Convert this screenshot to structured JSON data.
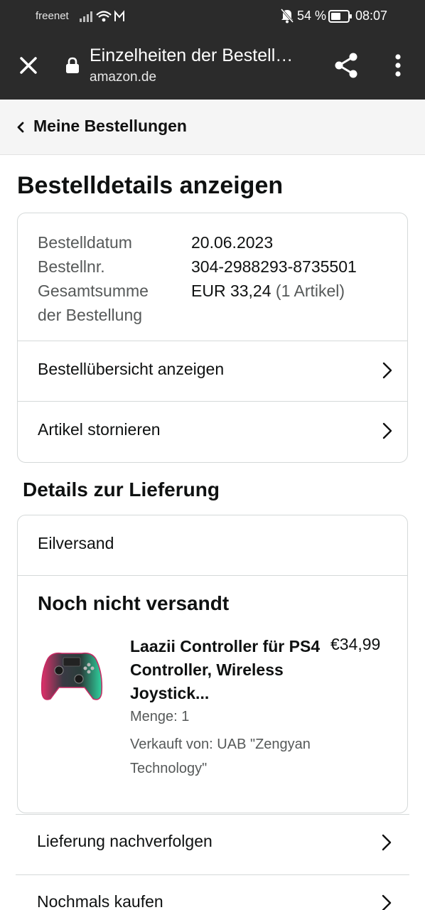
{
  "status_bar": {
    "carrier": "freenet",
    "battery": "54 %",
    "time": "08:07"
  },
  "browser": {
    "title": "Einzelheiten der Bestell…",
    "url": "amazon.de"
  },
  "breadcrumb": {
    "label": "Meine Bestellungen"
  },
  "page": {
    "heading": "Bestelldetails anzeigen"
  },
  "order": {
    "date_label": "Bestelldatum",
    "date_value": "20.06.2023",
    "number_label": "Bestellnr.",
    "number_value": "304-2988293-8735501",
    "total_label_1": "Gesamtsumme",
    "total_label_2": "der Bestellung",
    "total_value": "EUR 33,24",
    "total_items": "(1 Artikel)",
    "links": [
      {
        "label": "Bestellübersicht anzeigen"
      },
      {
        "label": "Artikel stornieren"
      }
    ]
  },
  "delivery": {
    "heading": "Details zur Lieferung",
    "shipping_type": "Eilversand",
    "status": "Noch nicht versandt",
    "item": {
      "name": "Laazii Controller für PS4 Controller, Wireless Joystick...",
      "price": "€34,99",
      "quantity": "Menge: 1",
      "seller": "Verkauft von: UAB \"Zengyan Technology\""
    }
  },
  "actions": [
    {
      "label": "Lieferung nachverfolgen"
    },
    {
      "label": "Nochmals kaufen"
    }
  ]
}
